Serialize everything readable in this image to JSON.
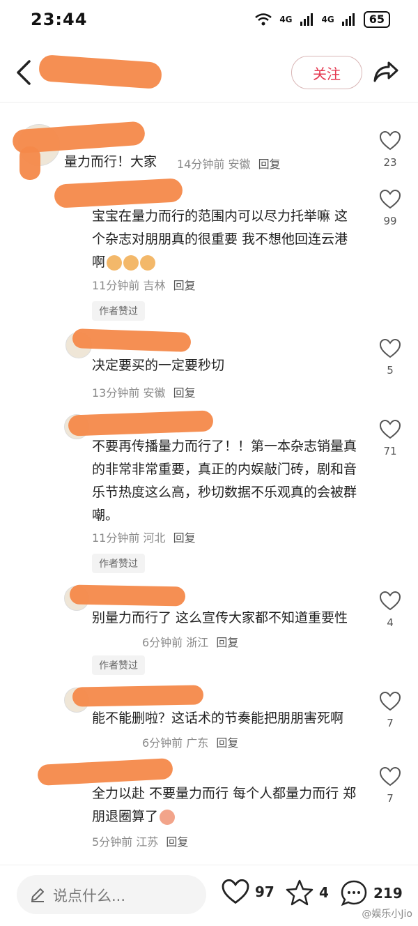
{
  "status_bar": {
    "time": "23:44",
    "network": "4G",
    "battery": "65"
  },
  "header": {
    "follow_label": "关注"
  },
  "comments": [
    {
      "text": "量力而行！大家",
      "time": "14分钟前",
      "location": "安徽",
      "reply": "回复",
      "likes": "23"
    },
    {
      "text": "宝宝在量力而行的范围内可以尽力托举嘛 这个杂志对朋朋真的很重要 我不想他回连云港啊",
      "time": "11分钟前",
      "location": "吉林",
      "reply": "回复",
      "badge": "作者赞过",
      "likes": "99"
    },
    {
      "text": "决定要买的一定要秒切",
      "time": "13分钟前",
      "location": "安徽",
      "reply": "回复",
      "likes": "5"
    },
    {
      "text": "不要再传播量力而行了！！第一本杂志销量真的非常非常重要，真正的内娱敲门砖，剧和音乐节热度这么高，秒切数据不乐观真的会被群嘲。",
      "time": "11分钟前",
      "location": "河北",
      "reply": "回复",
      "badge": "作者赞过",
      "likes": "71"
    },
    {
      "text": "别量力而行了 这么宣传大家都不知道重要性",
      "time": "6分钟前",
      "location": "浙江",
      "reply": "回复",
      "badge": "作者赞过",
      "likes": "4"
    },
    {
      "text": "能不能删啦？这话术的节奏能把朋朋害死啊",
      "time": "6分钟前",
      "location": "广东",
      "reply": "回复",
      "likes": "7"
    },
    {
      "text": "全力以赴 不要量力而行 每个人都量力而行 郑朋退圈算了",
      "time": "5分钟前",
      "location": "江苏",
      "reply": "回复",
      "likes": "7"
    }
  ],
  "bottom_bar": {
    "placeholder": "说点什么...",
    "likes": "97",
    "favorites": "4",
    "comments": "219"
  },
  "watermark": "@娱乐小Jio",
  "colors": {
    "accent": "#e4374f",
    "redaction": "#f4894a"
  }
}
